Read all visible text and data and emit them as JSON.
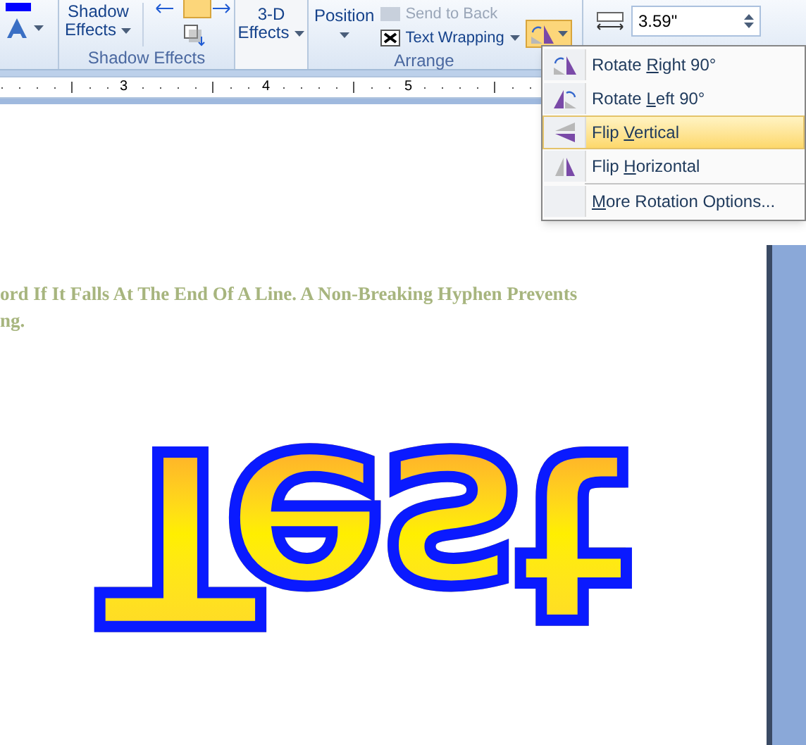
{
  "ribbon": {
    "groups": [
      {
        "kind": "partial"
      },
      {
        "kind": "shadow",
        "label": "Shadow Effects",
        "button": {
          "line1": "Shadow",
          "line2": "Effects"
        }
      },
      {
        "kind": "threed",
        "button": {
          "line1": "3-D",
          "line2": "Effects"
        }
      },
      {
        "kind": "arrange",
        "label": "Arrange",
        "position": "Position",
        "send_back": "Send to Back",
        "text_wrapping": "Text Wrapping",
        "rotate_selected": true
      },
      {
        "kind": "size",
        "value": "3.59\""
      }
    ]
  },
  "ruler": {
    "marks": [
      "3",
      "4",
      "5"
    ]
  },
  "menu": {
    "items": [
      {
        "before": "Rotate ",
        "key": "R",
        "after": "ight 90°",
        "selected": false
      },
      {
        "before": "Rotate ",
        "key": "L",
        "after": "eft 90°",
        "selected": false
      },
      {
        "before": "Flip ",
        "key": "V",
        "after": "ertical",
        "selected": true
      },
      {
        "before": "Flip ",
        "key": "H",
        "after": "orizontal",
        "selected": false
      },
      {
        "key": "M",
        "after": "ore Rotation Options...",
        "selected": false
      }
    ]
  },
  "document": {
    "lines": [
      "ord If It Falls At The End Of A Line. A Non-Breaking Hyphen Prevents",
      "ng."
    ],
    "wordart": {
      "text": "Test",
      "flipped_vertical": true
    }
  }
}
